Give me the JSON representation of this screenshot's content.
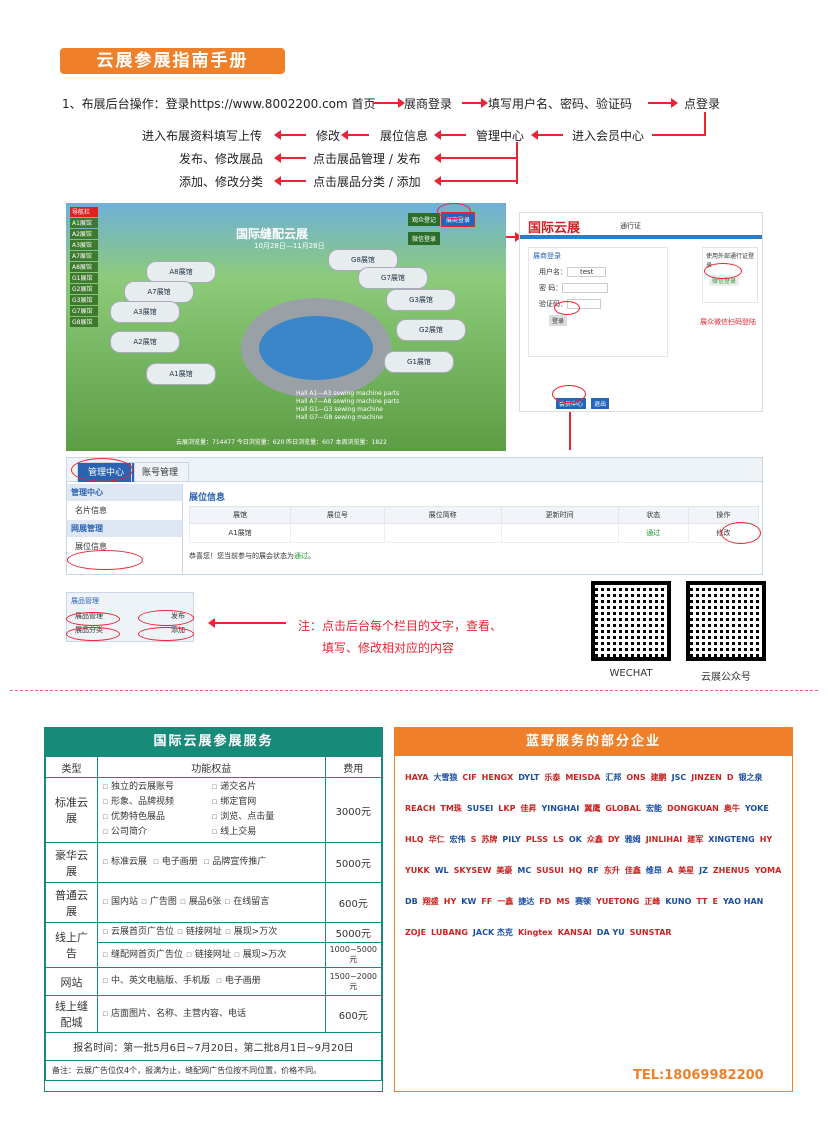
{
  "banner": "云展参展指南手册",
  "steps": {
    "s1": "1、布展后台操作：登录https://www.8002200.com 首页",
    "s2": "展商登录",
    "s3": "填写用户名、密码、验证码",
    "s4": "点登录",
    "r2a": "进入布展资料填写上传",
    "r2b": "修改",
    "r2c": "展位信息",
    "r2d": "管理中心",
    "r2e": "进入会员中心",
    "r3a": "发布、修改展品",
    "r3b": "点击展品管理 / 发布",
    "r4a": "添加、修改分类",
    "r4b": "点击展品分类 / 添加"
  },
  "map": {
    "title": "国际缝配云展",
    "dates": "10月28日—11月28日",
    "side": [
      "导航栏",
      "A1展馆",
      "A2展馆",
      "A3展馆",
      "A7展馆",
      "A8展馆",
      "G1展馆",
      "G2展馆",
      "G3展馆",
      "G7展馆",
      "G8展馆"
    ],
    "btns": [
      "观众登记",
      "展商登录",
      "微信登录"
    ],
    "halls": [
      "A8展馆",
      "A7展馆",
      "A3展馆",
      "A2展馆",
      "A1展馆",
      "G8展馆",
      "G7展馆",
      "G3展馆",
      "G2展馆",
      "G1展馆"
    ],
    "legend": [
      "Hall A1—A3 sewing machine parts",
      "Hall A7—A8 sewing machine parts",
      "Hall G1—G3 sewing machine",
      "Hall G7—G8 sewing machine"
    ],
    "footer": "云展浏览量：714477   今日浏览量：620   昨日浏览量：607   本周浏览量：1822"
  },
  "login": {
    "logo": "国际云展",
    "sub": "通行证",
    "title": "展商登录",
    "user_label": "用户名：",
    "user_val": "test",
    "pass_label": "密 码：",
    "code_label": "验证码：",
    "login_btn": "登录",
    "ext_title": "使用外部通行证登录",
    "wechat_btn": "微信登录",
    "note": "展众微信扫码登陆",
    "member": "会员中心",
    "exit": "退出"
  },
  "mgmt": {
    "tab1": "管理中心",
    "tab2": "账号管理",
    "nav_hd1": "管理中心",
    "nav1": "名片信息",
    "nav_hd2": "网展管理",
    "nav2": "展位信息",
    "section": "展位信息",
    "cols": [
      "展馆",
      "展位号",
      "展位简称",
      "更新时间",
      "状态",
      "操作"
    ],
    "row": [
      "A1展馆",
      "",
      "",
      "",
      "通过",
      "修改"
    ],
    "congrats_pre": "恭喜您！您当前参与的展会状态为",
    "congrats_status": "通过",
    "congrats_post": "。"
  },
  "prod": {
    "hd": "展品管理",
    "r1": "展品管理",
    "r1b": "发布",
    "r2": "展品分类",
    "r2b": "添加"
  },
  "note": {
    "l1": "注：点击后台每个栏目的文字，查看、",
    "l2": "填写、修改相对应的内容"
  },
  "qr": {
    "a": "WECHAT",
    "b": "云展公众号"
  },
  "svc": {
    "title": "国际云展参展服务",
    "cols": [
      "类型",
      "功能权益",
      "费用"
    ],
    "r1": {
      "type": "标准云展",
      "f": [
        "独立的云展账号",
        "递交名片",
        "形象、品牌视频",
        "绑定官网",
        "优势特色展品",
        "浏览、点击量",
        "公司简介",
        "线上交易"
      ],
      "fee": "3000元"
    },
    "r2": {
      "type": "豪华云展",
      "f": [
        "标准云展",
        "电子画册",
        "品牌宣传推广"
      ],
      "fee": "5000元"
    },
    "r3": {
      "type": "普通云展",
      "f": [
        "国内站",
        "广告图",
        "展品6张",
        "在线留言"
      ],
      "fee": "600元"
    },
    "r4": {
      "type": "线上广告",
      "f1": [
        "云展首页广告位",
        "链接网址",
        "展现>万次"
      ],
      "fee1": "5000元",
      "f2": [
        "缝配网首页广告位",
        "链接网址",
        "展现>万次"
      ],
      "fee2": "1000~5000元"
    },
    "r5": {
      "type": "网站",
      "f": [
        "中、英文电脑版、手机版",
        "电子画册"
      ],
      "fee": "1500~2000元"
    },
    "r6": {
      "type": "线上缝配城",
      "f": [
        "店面图片、名称、主营内容、电话"
      ],
      "fee": "600元"
    },
    "reg": "报名时间：第一批5月6日~7月20日，第二批8月1日~9月20日",
    "memo": "备注：云展广告位仅4个，报满为止，缝配网广告位按不同位置，价格不同。"
  },
  "partners": {
    "title": "蓝野服务的部分企业",
    "logos": [
      "HAYA",
      "大雪狼",
      "CIF",
      "HENGX",
      "DYLT",
      "乐泰",
      "MEISDA",
      "汇邦",
      "ONS",
      "建鹏",
      "JSC",
      "JINZEN",
      "D",
      "银之泉",
      "REACH",
      "TM珠",
      "SUSEI",
      "LKP",
      "佳昇",
      "YINGHAI",
      "翼鹰",
      "GLOBAL",
      "宏能",
      "DONGKUAN",
      "奥牛",
      "YOKE",
      "HLQ",
      "华仁",
      "宏伟",
      "S",
      "苏牌",
      "PILY",
      "PLSS",
      "LS",
      "OK",
      "众鑫",
      "DY",
      "雅姆",
      "JINLIHAI",
      "建军",
      "XINGTENG",
      "HY",
      "YUKK",
      "WL",
      "SKYSEW",
      "美豪",
      "MC",
      "SUSUI",
      "HQ",
      "RF",
      "东升",
      "佳鑫",
      "维昂",
      "A",
      "美星",
      "JZ",
      "ZHENUS",
      "YOMA",
      "DB",
      "翔盛",
      "HY",
      "KW",
      "FF",
      "一鑫",
      "捷达",
      "FD",
      "MS",
      "赛顿",
      "YUETONG",
      "正峰",
      "KUNO",
      "TT",
      "E",
      "YAO HAN",
      "ZOJE",
      "LUBANG",
      "JACK 杰克",
      "Kingtex",
      "KANSAI",
      "DA YU",
      "SUNSTAR"
    ],
    "tel": "TEL:18069982200"
  }
}
